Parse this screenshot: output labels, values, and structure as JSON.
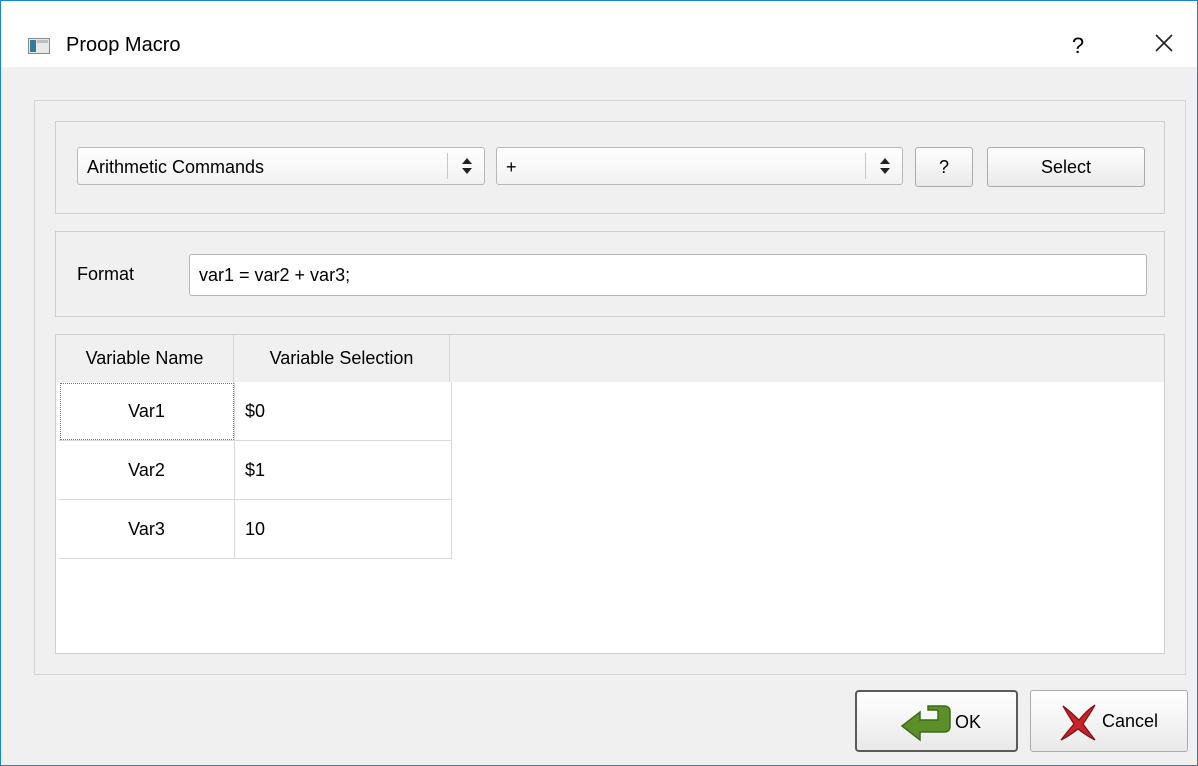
{
  "window": {
    "title": "Proop Macro",
    "help_label": "?",
    "icons": {
      "app": "app-window-icon",
      "close": "close-icon"
    }
  },
  "commands": {
    "category_value": "Arithmetic Commands",
    "operator_value": "+",
    "help_label": "?",
    "select_label": "Select"
  },
  "format": {
    "label": "Format",
    "value": "var1 = var2 + var3;"
  },
  "table": {
    "headers": [
      "Variable Name",
      "Variable Selection"
    ],
    "rows": [
      {
        "name": "Var1",
        "selection": "$0"
      },
      {
        "name": "Var2",
        "selection": "$1"
      },
      {
        "name": "Var3",
        "selection": "10"
      }
    ]
  },
  "footer": {
    "ok_label": "OK",
    "cancel_label": "Cancel",
    "icons": {
      "ok": "green-arrow-icon",
      "cancel": "red-x-icon"
    }
  },
  "colors": {
    "window_border": "#1883d7",
    "dialog_bg": "#f0f0f0"
  }
}
